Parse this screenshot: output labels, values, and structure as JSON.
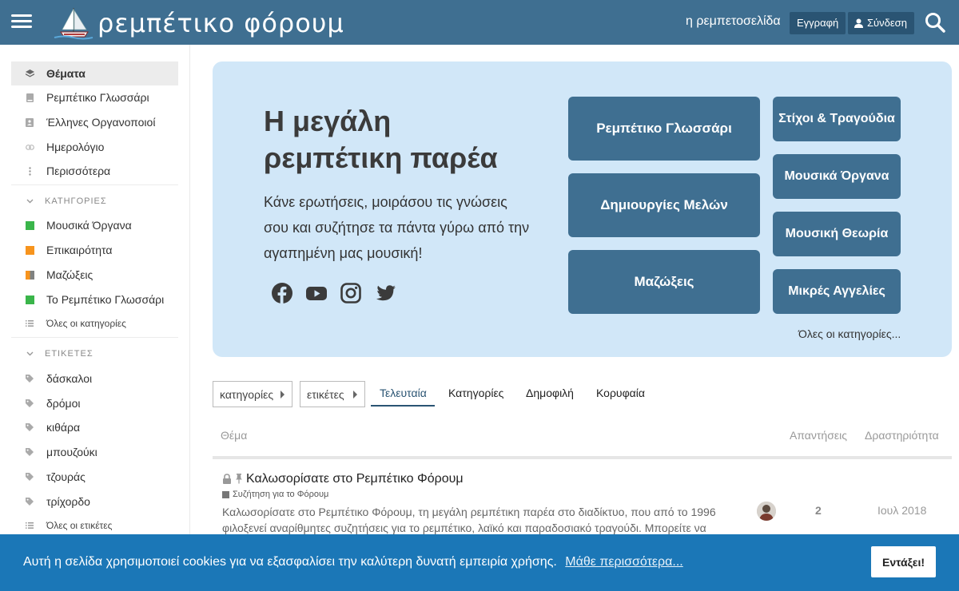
{
  "header": {
    "site_title": "ρεμπέτικο φόρουμ",
    "home_link": "η ρεμπετοσελίδα",
    "register_label": "Εγγραφή",
    "login_label": "Σύνδεση",
    "bg_color": "#3f6f91"
  },
  "sidebar": {
    "nav": [
      {
        "label": "Θέματα",
        "icon": "layers-icon",
        "active": true
      },
      {
        "label": "Ρεμπέτικο Γλωσσάρι",
        "icon": "book-icon"
      },
      {
        "label": "Έλληνες Οργανοποιοί",
        "icon": "address-book-icon"
      },
      {
        "label": "Ημερολόγιο",
        "icon": "link-icon"
      },
      {
        "label": "Περισσότερα",
        "icon": "ellipsis-vertical-icon"
      }
    ],
    "categories_heading": "ΚΑΤΗΓΟΡΙΕΣ",
    "categories": [
      {
        "label": "Μουσικά Όργανα",
        "color": "#3ab54a"
      },
      {
        "label": "Επικαιρότητα",
        "color": "#f7941d"
      },
      {
        "label": "Μαζώξεις",
        "color": "#f7941d",
        "color2": "#808281"
      },
      {
        "label": "Το Ρεμπέτικο Γλωσσάρι",
        "color": "#3ab54a"
      }
    ],
    "all_categories": "Όλες οι κατηγορίες",
    "tags_heading": "ΕΤΙΚΕΤΕΣ",
    "tags": [
      "δάσκαλοι",
      "δρόμοι",
      "κιθάρα",
      "μπουζούκι",
      "τζουράς",
      "τρίχορδο"
    ],
    "all_tags": "Όλες οι ετικέτες"
  },
  "hero": {
    "title": "Η μεγάλη ρεμπέτικη παρέα",
    "text": "Κάνε ερωτήσεις, μοιράσου τις γνώσεις σου και συζήτησε τα πάντα γύρω από την αγαπημένη μας μουσική!",
    "social": [
      "facebook-icon",
      "youtube-icon",
      "instagram-icon",
      "twitter-icon"
    ],
    "tiles_large": [
      "Ρεμπέτικο Γλωσσάρι",
      "Δημιουργίες Μελών",
      "Μαζώξεις"
    ],
    "tiles_small": [
      "Στίχοι & Τραγούδια",
      "Μουσικά Όργανα",
      "Μουσική Θεωρία",
      "Μικρές Αγγελίες"
    ],
    "all_categories": "Όλες οι κατηγορίες...",
    "bg_color": "#d1e7f8",
    "tile_color": "#3f6f91"
  },
  "nav": {
    "categories_drop": "κατηγορίες",
    "tags_drop": "ετικέτες",
    "tabs": [
      "Τελευταία",
      "Κατηγορίες",
      "Δημοφιλή",
      "Κορυφαία"
    ]
  },
  "table": {
    "col_topic": "Θέμα",
    "col_replies": "Απαντήσεις",
    "col_activity": "Δραστηριότητα",
    "rows": [
      {
        "title": "Καλωσορίσατε στο Ρεμπέτικο Φόρουμ",
        "category": "Συζήτηση για το Φόρουμ",
        "excerpt": "Καλωσορίσατε στο Ρεμπέτικο Φόρουμ, τη μεγάλη ρεμπέτικη παρέα στο διαδίκτυο, που από το 1996 φιλοξενεί αναρίθμητες συζητήσεις για το ρεμπέτικο, λαϊκό και παραδοσιακό τραγούδι. Μπορείτε να",
        "replies": "2",
        "activity": "Ιουλ 2018"
      }
    ]
  },
  "cookie": {
    "text": "Αυτή η σελίδα χρησιμοποιεί cookies για να εξασφαλίσει την καλύτερη δυνατή εμπειρία χρήσης.",
    "link": "Μάθε περισσότερα...",
    "button": "Εντάξει!",
    "bg_color": "#1b77b7"
  }
}
